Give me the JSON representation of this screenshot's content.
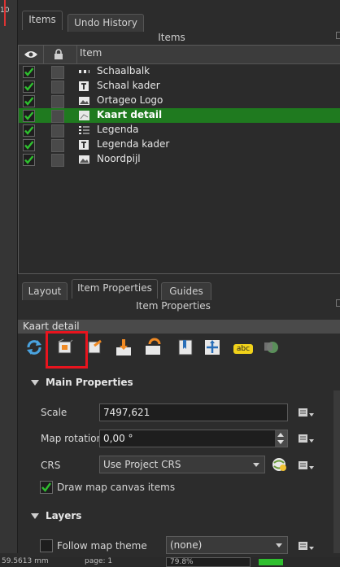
{
  "ruler": {
    "tick_label": "10"
  },
  "top_tabs": [
    {
      "label": "Items",
      "active": true
    },
    {
      "label": "Undo History",
      "active": false
    }
  ],
  "items_panel": {
    "title": "Items",
    "column_item": "Item",
    "rows": [
      {
        "label": "Schaalbalk",
        "icon": "scalebar-icon",
        "visible": true,
        "selected": false
      },
      {
        "label": "Schaal kader",
        "icon": "label-icon",
        "visible": true,
        "selected": false
      },
      {
        "label": "Ortageo Logo",
        "icon": "picture-icon",
        "visible": true,
        "selected": false
      },
      {
        "label": "Kaart detail",
        "icon": "map-icon",
        "visible": true,
        "selected": true
      },
      {
        "label": "Legenda",
        "icon": "legend-icon",
        "visible": true,
        "selected": false
      },
      {
        "label": "Legenda kader",
        "icon": "label-icon",
        "visible": true,
        "selected": false
      },
      {
        "label": "Noordpijl",
        "icon": "picture-icon",
        "visible": true,
        "selected": false
      }
    ]
  },
  "bottom_tabs": [
    {
      "label": "Layout",
      "active": false
    },
    {
      "label": "Item Properties",
      "active": true
    },
    {
      "label": "Guides",
      "active": false
    }
  ],
  "properties": {
    "title": "Item Properties",
    "item_name": "Kaart detail",
    "main_section": "Main Properties",
    "scale_label": "Scale",
    "scale_value": "7497,621",
    "rotation_label": "Map rotation",
    "rotation_value": "0,00 °",
    "crs_label": "CRS",
    "crs_value": "Use Project CRS",
    "draw_canvas_label": "Draw map canvas items",
    "layers_section": "Layers",
    "follow_theme_label": "Follow map theme",
    "follow_theme_value": "(none)",
    "toolbar_badge": "abc"
  },
  "status": {
    "coords": "59.5613 mm",
    "page": "page: 1",
    "zoom": "79.8%"
  },
  "colors": {
    "highlight_red": "#e8141e",
    "selection_green": "#1f7a1f",
    "check_green": "#2fbf2f"
  }
}
